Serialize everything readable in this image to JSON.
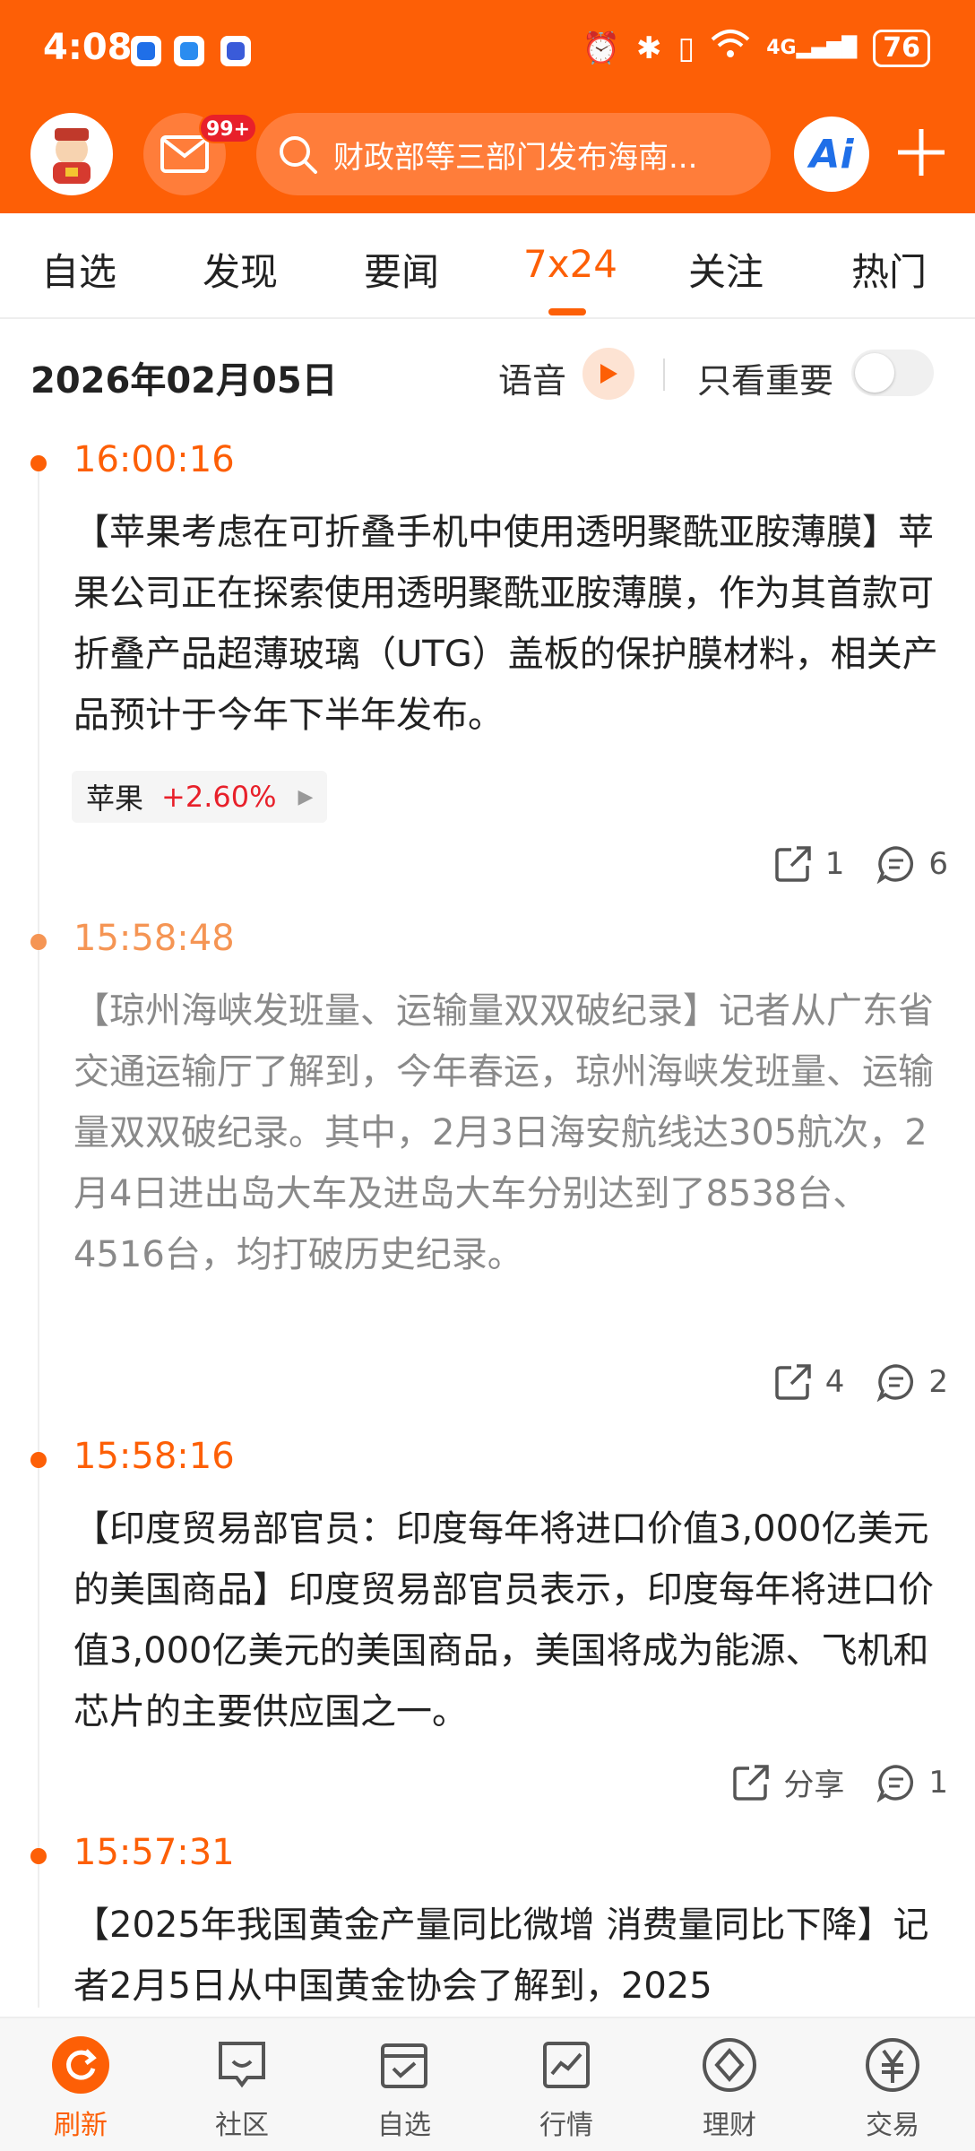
{
  "status_bar": {
    "time": "4:08",
    "network": "4G",
    "battery": "76"
  },
  "header": {
    "badge": "99+",
    "search_placeholder": "财政部等三部门发布海南...",
    "ai_label": "Ai"
  },
  "tabs": [
    {
      "label": "自选"
    },
    {
      "label": "发现"
    },
    {
      "label": "要闻"
    },
    {
      "label": "7x24",
      "active": true
    },
    {
      "label": "关注"
    },
    {
      "label": "热门"
    }
  ],
  "datebar": {
    "date": "2026年02月05日",
    "voice_label": "语音",
    "important_label": "只看重要",
    "important_only": false
  },
  "feed": [
    {
      "time": "16:00:16",
      "text": "【苹果考虑在可折叠手机中使用透明聚酰亚胺薄膜】苹果公司正在探索使用透明聚酰亚胺薄膜，作为其首款可折叠产品超薄玻璃（UTG）盖板的保护膜材料，相关产品预计于今年下半年发布。",
      "stock": {
        "name": "苹果",
        "change": "+2.60%"
      },
      "share": "1",
      "comments": "6"
    },
    {
      "time": "15:58:48",
      "text": "【琼州海峡发班量、运输量双双破纪录】记者从广东省交通运输厅了解到，今年春运，琼州海峡发班量、运输量双双破纪录。其中，2月3日海安航线达305航次，2月4日进出岛大车及进岛大车分别达到了8538台、4516台，均打破历史纪录。",
      "share": "4",
      "comments": "2"
    },
    {
      "time": "15:58:16",
      "text": "【印度贸易部官员：印度每年将进口价值3,000亿美元的美国商品】印度贸易部官员表示，印度每年将进口价值3,000亿美元的美国商品，美国将成为能源、飞机和芯片的主要供应国之一。",
      "share": "分享",
      "comments": "1"
    },
    {
      "time": "15:57:31",
      "text": "【2025年我国黄金产量同比微增 消费量同比下降】记者2月5日从中国黄金协会了解到，2025"
    }
  ],
  "bottom_nav": [
    {
      "label": "刷新",
      "icon": "refresh-icon",
      "active": true
    },
    {
      "label": "社区",
      "icon": "community-icon"
    },
    {
      "label": "自选",
      "icon": "watchlist-icon"
    },
    {
      "label": "行情",
      "icon": "market-icon"
    },
    {
      "label": "理财",
      "icon": "wealth-icon"
    },
    {
      "label": "交易",
      "icon": "trade-icon"
    }
  ],
  "colors": {
    "brand": "#fd5f06",
    "up": "#e8202a"
  }
}
